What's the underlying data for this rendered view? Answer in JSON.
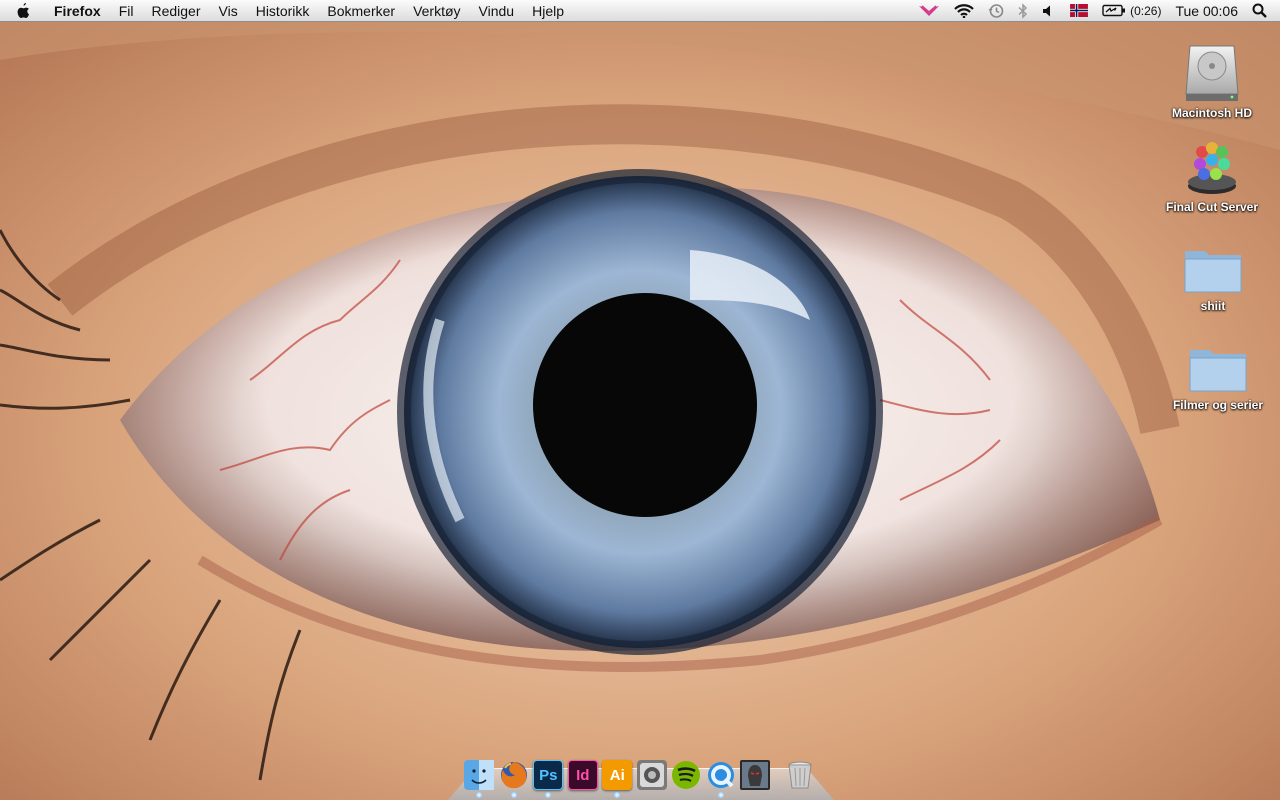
{
  "menubar": {
    "app_name": "Firefox",
    "items": [
      "Fil",
      "Rediger",
      "Vis",
      "Historikk",
      "Bokmerker",
      "Verktøy",
      "Vindu",
      "Hjelp"
    ],
    "battery_time": "(0:26)",
    "clock": "Tue 00:06",
    "tray_icons": [
      "wings-icon",
      "wifi-icon",
      "time-machine-icon",
      "bluetooth-icon",
      "volume-icon",
      "norway-flag-icon",
      "battery-icon",
      "spotlight-icon"
    ]
  },
  "desktop": {
    "icons": [
      {
        "label": "Macintosh HD",
        "icon": "hard-drive-icon"
      },
      {
        "label": "Final Cut Server",
        "icon": "final-cut-server-icon"
      },
      {
        "label": "shiit",
        "icon": "folder-icon"
      },
      {
        "label": "Filmer og serier",
        "icon": "folder-icon"
      }
    ]
  },
  "dock": {
    "apps": [
      {
        "name": "Finder",
        "icon": "finder-icon",
        "glyph": "",
        "running": true
      },
      {
        "name": "Firefox",
        "icon": "firefox-icon",
        "glyph": "",
        "running": true
      },
      {
        "name": "Photoshop",
        "icon": "photoshop-icon",
        "glyph": "Ps",
        "running": true
      },
      {
        "name": "InDesign",
        "icon": "indesign-icon",
        "glyph": "Id",
        "running": false
      },
      {
        "name": "Illustrator",
        "icon": "illustrator-icon",
        "glyph": "Ai",
        "running": true
      },
      {
        "name": "Compressor",
        "icon": "compressor-icon",
        "glyph": "",
        "running": false
      },
      {
        "name": "Spotify",
        "icon": "spotify-icon",
        "glyph": "",
        "running": false
      },
      {
        "name": "QuickTime",
        "icon": "quicktime-icon",
        "glyph": "",
        "running": true
      },
      {
        "name": "Game",
        "icon": "game-icon",
        "glyph": "",
        "running": false
      },
      {
        "name": "Trash",
        "icon": "trash-icon",
        "glyph": "",
        "running": false
      }
    ]
  },
  "colors": {
    "menubar_bg": "#e8e8e8",
    "photoshop": "#0b2a4a",
    "indesign": "#3a0a2a",
    "illustrator": "#f29a00",
    "spotify": "#7ab800",
    "iris": "#7d9cc4"
  }
}
